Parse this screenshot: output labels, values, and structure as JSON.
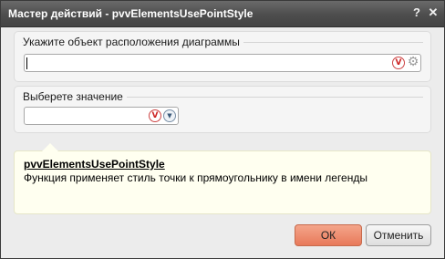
{
  "window": {
    "title": "Мастер действий - pvvElementsUsePointStyle",
    "help_symbol": "?",
    "close_symbol": "✕"
  },
  "object_field": {
    "label": "Укажите объект расположения диаграммы",
    "value": "",
    "icon_validate": "v-icon",
    "icon_settings": "gear-icon"
  },
  "value_field": {
    "label": "Выберете значение",
    "value": "",
    "icon_validate": "v-icon",
    "icon_dropdown": "chevron-down-icon"
  },
  "help": {
    "title": "pvvElementsUsePointStyle",
    "description": "Функция применяет стиль точки к прямоугольнику в имени легенды"
  },
  "buttons": {
    "ok": "ОК",
    "cancel": "Отменить"
  }
}
